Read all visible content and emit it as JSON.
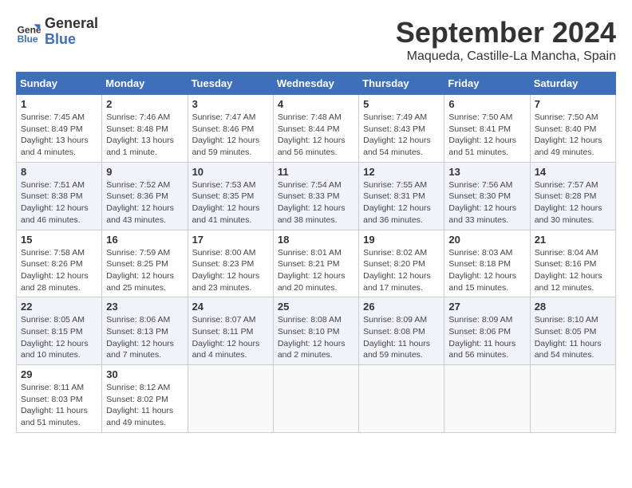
{
  "header": {
    "logo_line1": "General",
    "logo_line2": "Blue",
    "month": "September 2024",
    "location": "Maqueda, Castille-La Mancha, Spain"
  },
  "days_of_week": [
    "Sunday",
    "Monday",
    "Tuesday",
    "Wednesday",
    "Thursday",
    "Friday",
    "Saturday"
  ],
  "weeks": [
    [
      {
        "day": "1",
        "detail": "Sunrise: 7:45 AM\nSunset: 8:49 PM\nDaylight: 13 hours\nand 4 minutes."
      },
      {
        "day": "2",
        "detail": "Sunrise: 7:46 AM\nSunset: 8:48 PM\nDaylight: 13 hours\nand 1 minute."
      },
      {
        "day": "3",
        "detail": "Sunrise: 7:47 AM\nSunset: 8:46 PM\nDaylight: 12 hours\nand 59 minutes."
      },
      {
        "day": "4",
        "detail": "Sunrise: 7:48 AM\nSunset: 8:44 PM\nDaylight: 12 hours\nand 56 minutes."
      },
      {
        "day": "5",
        "detail": "Sunrise: 7:49 AM\nSunset: 8:43 PM\nDaylight: 12 hours\nand 54 minutes."
      },
      {
        "day": "6",
        "detail": "Sunrise: 7:50 AM\nSunset: 8:41 PM\nDaylight: 12 hours\nand 51 minutes."
      },
      {
        "day": "7",
        "detail": "Sunrise: 7:50 AM\nSunset: 8:40 PM\nDaylight: 12 hours\nand 49 minutes."
      }
    ],
    [
      {
        "day": "8",
        "detail": "Sunrise: 7:51 AM\nSunset: 8:38 PM\nDaylight: 12 hours\nand 46 minutes."
      },
      {
        "day": "9",
        "detail": "Sunrise: 7:52 AM\nSunset: 8:36 PM\nDaylight: 12 hours\nand 43 minutes."
      },
      {
        "day": "10",
        "detail": "Sunrise: 7:53 AM\nSunset: 8:35 PM\nDaylight: 12 hours\nand 41 minutes."
      },
      {
        "day": "11",
        "detail": "Sunrise: 7:54 AM\nSunset: 8:33 PM\nDaylight: 12 hours\nand 38 minutes."
      },
      {
        "day": "12",
        "detail": "Sunrise: 7:55 AM\nSunset: 8:31 PM\nDaylight: 12 hours\nand 36 minutes."
      },
      {
        "day": "13",
        "detail": "Sunrise: 7:56 AM\nSunset: 8:30 PM\nDaylight: 12 hours\nand 33 minutes."
      },
      {
        "day": "14",
        "detail": "Sunrise: 7:57 AM\nSunset: 8:28 PM\nDaylight: 12 hours\nand 30 minutes."
      }
    ],
    [
      {
        "day": "15",
        "detail": "Sunrise: 7:58 AM\nSunset: 8:26 PM\nDaylight: 12 hours\nand 28 minutes."
      },
      {
        "day": "16",
        "detail": "Sunrise: 7:59 AM\nSunset: 8:25 PM\nDaylight: 12 hours\nand 25 minutes."
      },
      {
        "day": "17",
        "detail": "Sunrise: 8:00 AM\nSunset: 8:23 PM\nDaylight: 12 hours\nand 23 minutes."
      },
      {
        "day": "18",
        "detail": "Sunrise: 8:01 AM\nSunset: 8:21 PM\nDaylight: 12 hours\nand 20 minutes."
      },
      {
        "day": "19",
        "detail": "Sunrise: 8:02 AM\nSunset: 8:20 PM\nDaylight: 12 hours\nand 17 minutes."
      },
      {
        "day": "20",
        "detail": "Sunrise: 8:03 AM\nSunset: 8:18 PM\nDaylight: 12 hours\nand 15 minutes."
      },
      {
        "day": "21",
        "detail": "Sunrise: 8:04 AM\nSunset: 8:16 PM\nDaylight: 12 hours\nand 12 minutes."
      }
    ],
    [
      {
        "day": "22",
        "detail": "Sunrise: 8:05 AM\nSunset: 8:15 PM\nDaylight: 12 hours\nand 10 minutes."
      },
      {
        "day": "23",
        "detail": "Sunrise: 8:06 AM\nSunset: 8:13 PM\nDaylight: 12 hours\nand 7 minutes."
      },
      {
        "day": "24",
        "detail": "Sunrise: 8:07 AM\nSunset: 8:11 PM\nDaylight: 12 hours\nand 4 minutes."
      },
      {
        "day": "25",
        "detail": "Sunrise: 8:08 AM\nSunset: 8:10 PM\nDaylight: 12 hours\nand 2 minutes."
      },
      {
        "day": "26",
        "detail": "Sunrise: 8:09 AM\nSunset: 8:08 PM\nDaylight: 11 hours\nand 59 minutes."
      },
      {
        "day": "27",
        "detail": "Sunrise: 8:09 AM\nSunset: 8:06 PM\nDaylight: 11 hours\nand 56 minutes."
      },
      {
        "day": "28",
        "detail": "Sunrise: 8:10 AM\nSunset: 8:05 PM\nDaylight: 11 hours\nand 54 minutes."
      }
    ],
    [
      {
        "day": "29",
        "detail": "Sunrise: 8:11 AM\nSunset: 8:03 PM\nDaylight: 11 hours\nand 51 minutes."
      },
      {
        "day": "30",
        "detail": "Sunrise: 8:12 AM\nSunset: 8:02 PM\nDaylight: 11 hours\nand 49 minutes."
      },
      {
        "day": "",
        "detail": ""
      },
      {
        "day": "",
        "detail": ""
      },
      {
        "day": "",
        "detail": ""
      },
      {
        "day": "",
        "detail": ""
      },
      {
        "day": "",
        "detail": ""
      }
    ]
  ]
}
